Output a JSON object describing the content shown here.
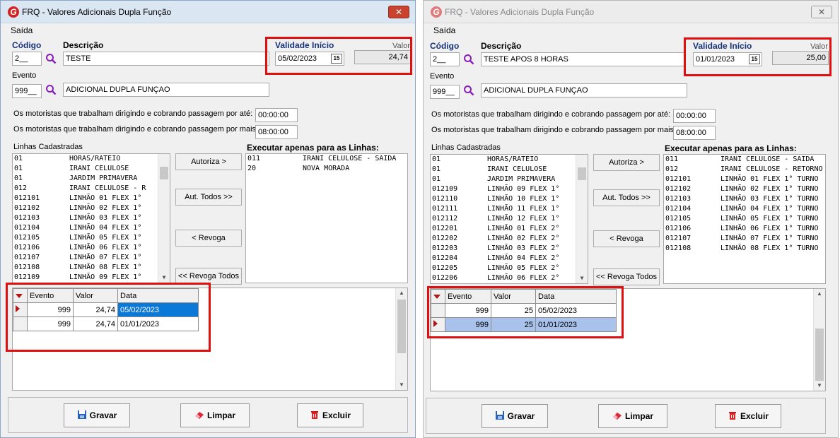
{
  "app": {
    "title": "FRQ - Valores Adicionais Dupla Função",
    "close_symbol": "✕",
    "menu_saida": "Saída",
    "accent_color": "#d42020"
  },
  "labels": {
    "codigo": "Código",
    "descricao": "Descrição",
    "validade": "Validade Início",
    "valor": "Valor",
    "evento": "Evento",
    "motoristas_ate": "Os motoristas que trabalham dirigindo e cobrando passagem por até:",
    "motoristas_mais": "Os motoristas que trabalham dirigindo e cobrando passagem por mais:",
    "linhas_cadastradas": "Linhas Cadastradas",
    "executar_linhas": "Executar apenas para as Linhas:"
  },
  "buttons": {
    "autoriza": "Autoriza >",
    "aut_todos": "Aut. Todos >>",
    "revoga": "< Revoga",
    "revoga_todos": "<< Revoga Todos",
    "gravar": "Gravar",
    "limpar": "Limpar",
    "excluir": "Excluir"
  },
  "grid_headers": {
    "evento": "Evento",
    "valor": "Valor",
    "data": "Data"
  },
  "window1": {
    "codigo": "2__",
    "descricao": "TESTE",
    "validade": "05/02/2023",
    "valor": "24,74",
    "evento_codigo": "999__",
    "evento_desc": "ADICIONAL DUPLA FUNÇAO",
    "tempo_ate": "00:00:00",
    "tempo_mais": "08:00:00",
    "linhas": [
      [
        "01",
        "HORAS/RATEIO"
      ],
      [
        "01",
        "IRANI CELULOSE"
      ],
      [
        "01",
        "JARDIM PRIMAVERA"
      ],
      [
        "012",
        "IRANI CELULOSE - R"
      ],
      [
        "012101",
        "LINHÃO 01 FLEX 1°"
      ],
      [
        "012102",
        "LINHÃO 02 FLEX 1°"
      ],
      [
        "012103",
        "LINHÃO 03 FLEX 1°"
      ],
      [
        "012104",
        "LINHÃO 04 FLEX 1°"
      ],
      [
        "012105",
        "LINHÃO 05 FLEX 1°"
      ],
      [
        "012106",
        "LINHÃO 06 FLEX 1°"
      ],
      [
        "012107",
        "LINHÃO 07 FLEX 1°"
      ],
      [
        "012108",
        "LINHÃO 08 FLEX 1°"
      ],
      [
        "012109",
        "LINHÃO 09 FLEX 1°"
      ]
    ],
    "executar": [
      [
        "011",
        "IRANI CELULOSE - SAIDA"
      ],
      [
        "20",
        "NOVA MORADA"
      ]
    ],
    "grid_rows": [
      [
        "999",
        "24,74",
        "05/02/2023"
      ],
      [
        "999",
        "24,74",
        "01/01/2023"
      ]
    ]
  },
  "window2": {
    "codigo": "2__",
    "descricao": "TESTE APOS 8 HORAS",
    "validade": "01/01/2023",
    "valor": "25,00",
    "evento_codigo": "999__",
    "evento_desc": "ADICIONAL DUPLA FUNÇAO",
    "tempo_ate": "00:00:00",
    "tempo_mais": "08:00:00",
    "linhas": [
      [
        "01",
        "HORAS/RATEIO"
      ],
      [
        "01",
        "IRANI CELULOSE"
      ],
      [
        "01",
        "JARDIM PRIMAVERA"
      ],
      [
        "012109",
        "LINHÃO 09 FLEX 1°"
      ],
      [
        "012110",
        "LINHÃO 10 FLEX 1°"
      ],
      [
        "012111",
        "LINHÃO 11 FLEX 1°"
      ],
      [
        "012112",
        "LINHÃO 12 FLEX 1°"
      ],
      [
        "012201",
        "LINHÃO 01 FLEX 2°"
      ],
      [
        "012202",
        "LINHÃO 02 FLEX 2°"
      ],
      [
        "012203",
        "LINHÃO 03 FLEX 2°"
      ],
      [
        "012204",
        "LINHÃO 04 FLEX 2°"
      ],
      [
        "012205",
        "LINHÃO 05 FLEX 2°"
      ],
      [
        "012206",
        "LINHÃO 06 FLEX 2°"
      ]
    ],
    "executar": [
      [
        "011",
        "IRANI CELULOSE - SAIDA"
      ],
      [
        "012",
        "IRANI CELULOSE - RETORNO"
      ],
      [
        "012101",
        "LINHÃO 01 FLEX 1° TURNO"
      ],
      [
        "012102",
        "LINHÃO 02 FLEX 1° TURNO"
      ],
      [
        "012103",
        "LINHÃO 03 FLEX 1° TURNO"
      ],
      [
        "012104",
        "LINHÃO 04 FLEX 1° TURNO"
      ],
      [
        "012105",
        "LINHÃO 05 FLEX 1° TURNO"
      ],
      [
        "012106",
        "LINHÃO 06 FLEX 1° TURNO"
      ],
      [
        "012107",
        "LINHÃO 07 FLEX 1° TURNO"
      ],
      [
        "012108",
        "LINHÃO 08 FLEX 1° TURNO"
      ]
    ],
    "grid_rows": [
      [
        "999",
        "25",
        "05/02/2023"
      ],
      [
        "999",
        "25",
        "01/01/2023"
      ]
    ]
  }
}
